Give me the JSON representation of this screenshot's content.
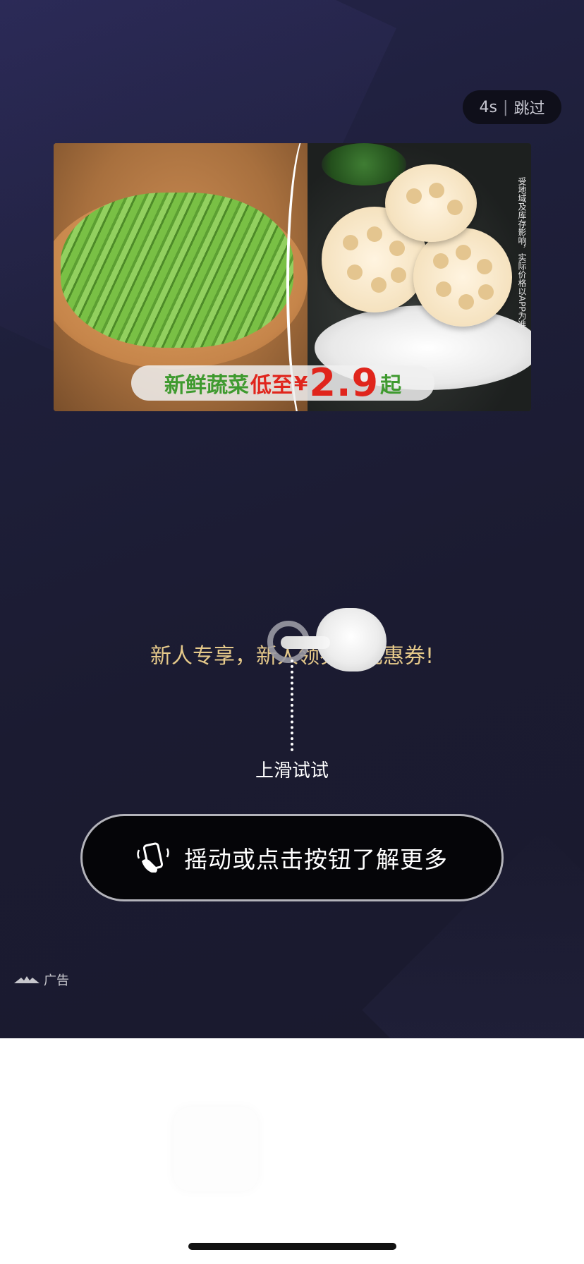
{
  "skip": {
    "countdown": "4s",
    "separator": "|",
    "label": "跳过"
  },
  "banner": {
    "headline_green": "新鲜蔬菜",
    "headline_red": "低至",
    "currency": "¥",
    "price": "2.9",
    "suffix": "起",
    "side_note": "受地域及库存影响，实际价格以APP为准"
  },
  "promo": {
    "text": "新人专享，新人领券，优惠券!"
  },
  "swipe": {
    "hint": "上滑试试"
  },
  "cta": {
    "label": "摇动或点击按钮了解更多",
    "icon": "shake-phone-icon"
  },
  "ad_label": {
    "text": "广告",
    "logo": "ad-network-logo-icon"
  },
  "colors": {
    "background": "#1c1c32",
    "promo_text": "#e5c98a",
    "cta_background": "#050508",
    "price_red": "#e0251c",
    "headline_green": "#3f9a2f"
  }
}
